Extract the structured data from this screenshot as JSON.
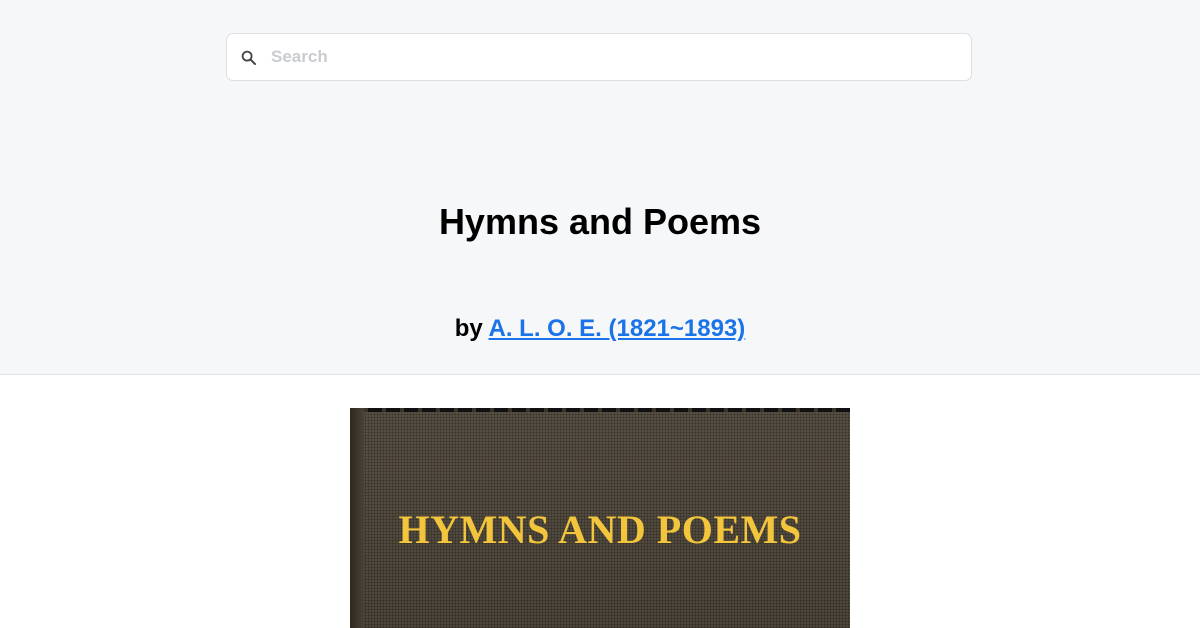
{
  "search": {
    "placeholder": "Search",
    "value": "",
    "icon": "search-icon"
  },
  "book": {
    "title": "Hymns and Poems",
    "by_prefix": "by",
    "author_link": "A. L. O. E. (1821~1893)",
    "cover_title": "HYMNS AND POEMS"
  },
  "colors": {
    "header_bg": "#f6f7f9",
    "link": "#1a73e8",
    "cover_title": "#f2c53d",
    "cover_cloth": "#453d31"
  }
}
